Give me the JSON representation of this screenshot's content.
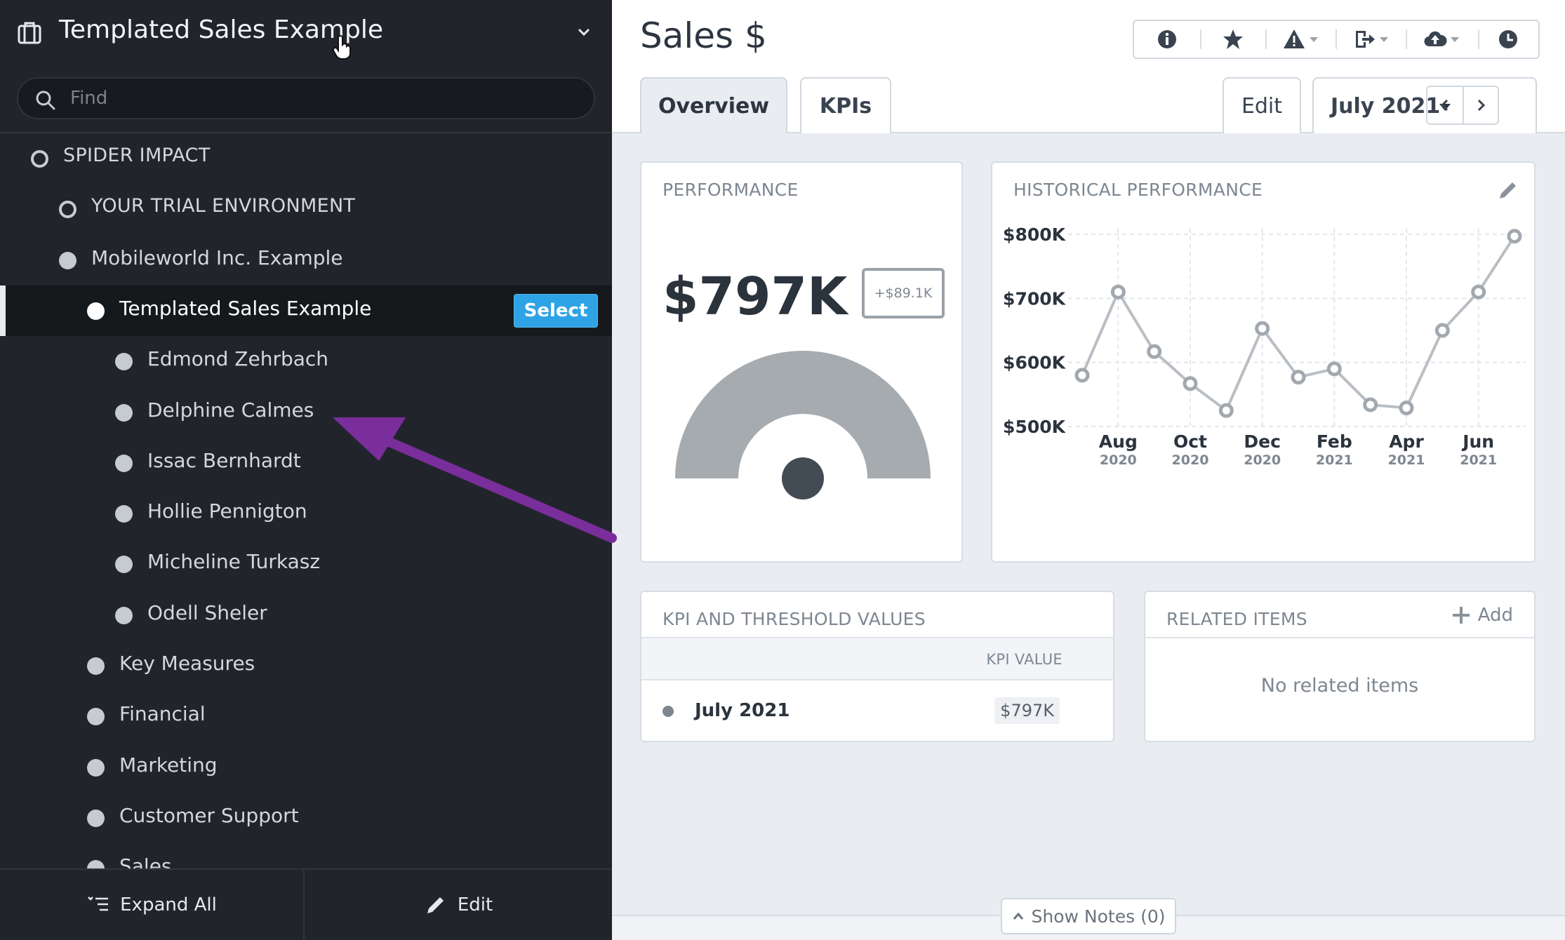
{
  "sidebar": {
    "title": "Templated Sales Example",
    "search_placeholder": "Find",
    "tree": [
      {
        "label": "SPIDER IMPACT",
        "level": 0,
        "style": "ring",
        "upper": true
      },
      {
        "label": "YOUR TRIAL ENVIRONMENT",
        "level": 1,
        "style": "ring",
        "upper": true
      },
      {
        "label": "Mobileworld Inc. Example",
        "level": 1,
        "style": "filled"
      },
      {
        "label": "Templated Sales Example",
        "level": 2,
        "style": "white",
        "selected": true
      },
      {
        "label": "Edmond Zehrbach",
        "level": 3,
        "style": "filled"
      },
      {
        "label": "Delphine Calmes",
        "level": 3,
        "style": "filled"
      },
      {
        "label": "Issac Bernhardt",
        "level": 3,
        "style": "filled"
      },
      {
        "label": "Hollie Pennigton",
        "level": 3,
        "style": "filled"
      },
      {
        "label": "Micheline Turkasz",
        "level": 3,
        "style": "filled"
      },
      {
        "label": "Odell Sheler",
        "level": 3,
        "style": "filled"
      },
      {
        "label": "Key Measures",
        "level": 2,
        "style": "filled"
      },
      {
        "label": "Financial",
        "level": 2,
        "style": "filled"
      },
      {
        "label": "Marketing",
        "level": 2,
        "style": "filled"
      },
      {
        "label": "Customer Support",
        "level": 2,
        "style": "filled"
      },
      {
        "label": "Sales",
        "level": 2,
        "style": "filled"
      }
    ],
    "select_label": "Select",
    "footer": {
      "expand_all": "Expand All",
      "edit": "Edit"
    }
  },
  "header": {
    "title": "Sales $",
    "toolbar_icons": [
      "info-icon",
      "star-icon",
      "warning-icon",
      "export-icon",
      "cloud-upload-icon",
      "clock-icon"
    ]
  },
  "tabs": {
    "overview": "Overview",
    "kpis": "KPIs",
    "edit": "Edit",
    "period": "July 2021"
  },
  "performance": {
    "title": "PERFORMANCE",
    "value": "$797K",
    "delta": "+$89.1K"
  },
  "historical": {
    "title": "HISTORICAL PERFORMANCE"
  },
  "chart_data": {
    "type": "line",
    "title": "HISTORICAL PERFORMANCE",
    "x": [
      "Jul 2020",
      "Aug 2020",
      "Sep 2020",
      "Oct 2020",
      "Nov 2020",
      "Dec 2020",
      "Jan 2021",
      "Feb 2021",
      "Mar 2021",
      "Apr 2021",
      "May 2021",
      "Jun 2021",
      "Jul 2021"
    ],
    "values": [
      580,
      710,
      617,
      567,
      525,
      653,
      577,
      590,
      534,
      529,
      650,
      710,
      797
    ],
    "ylim": [
      500,
      800
    ],
    "y_ticks": [
      "$500K",
      "$600K",
      "$700K",
      "$800K"
    ],
    "x_tick_labels": [
      {
        "month": "Aug",
        "year": "2020"
      },
      {
        "month": "Oct",
        "year": "2020"
      },
      {
        "month": "Dec",
        "year": "2020"
      },
      {
        "month": "Feb",
        "year": "2021"
      },
      {
        "month": "Apr",
        "year": "2021"
      },
      {
        "month": "Jun",
        "year": "2021"
      }
    ],
    "x_tick_indices": [
      1,
      3,
      5,
      7,
      9,
      11
    ],
    "grid": true,
    "line_color": "#b9bec4"
  },
  "kpi_table": {
    "title": "KPI AND THRESHOLD VALUES",
    "column": "KPI VALUE",
    "row_period": "July 2021",
    "row_value": "$797K"
  },
  "related": {
    "title": "RELATED ITEMS",
    "add": "Add",
    "empty": "No related items"
  },
  "notes": {
    "label": "Show Notes (0)"
  }
}
